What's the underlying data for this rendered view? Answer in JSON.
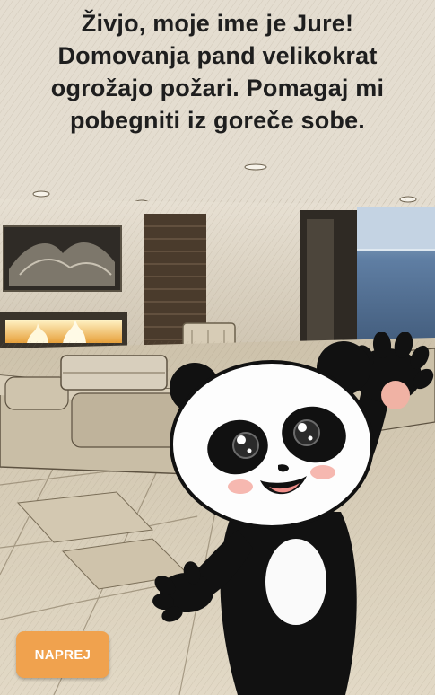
{
  "intro": {
    "lines": [
      "Živjo, moje ime je Jure!",
      "Domovanja pand velikokrat",
      "ogrožajo požari. Pomagaj mi",
      "pobegniti iz goreče sobe."
    ]
  },
  "next_button": {
    "label": "NAPREJ",
    "color": "#f0a24e"
  },
  "character": {
    "icon": "panda-character-icon"
  },
  "colors": {
    "text": "#1e1e1e",
    "background": "#d9d0bf"
  }
}
